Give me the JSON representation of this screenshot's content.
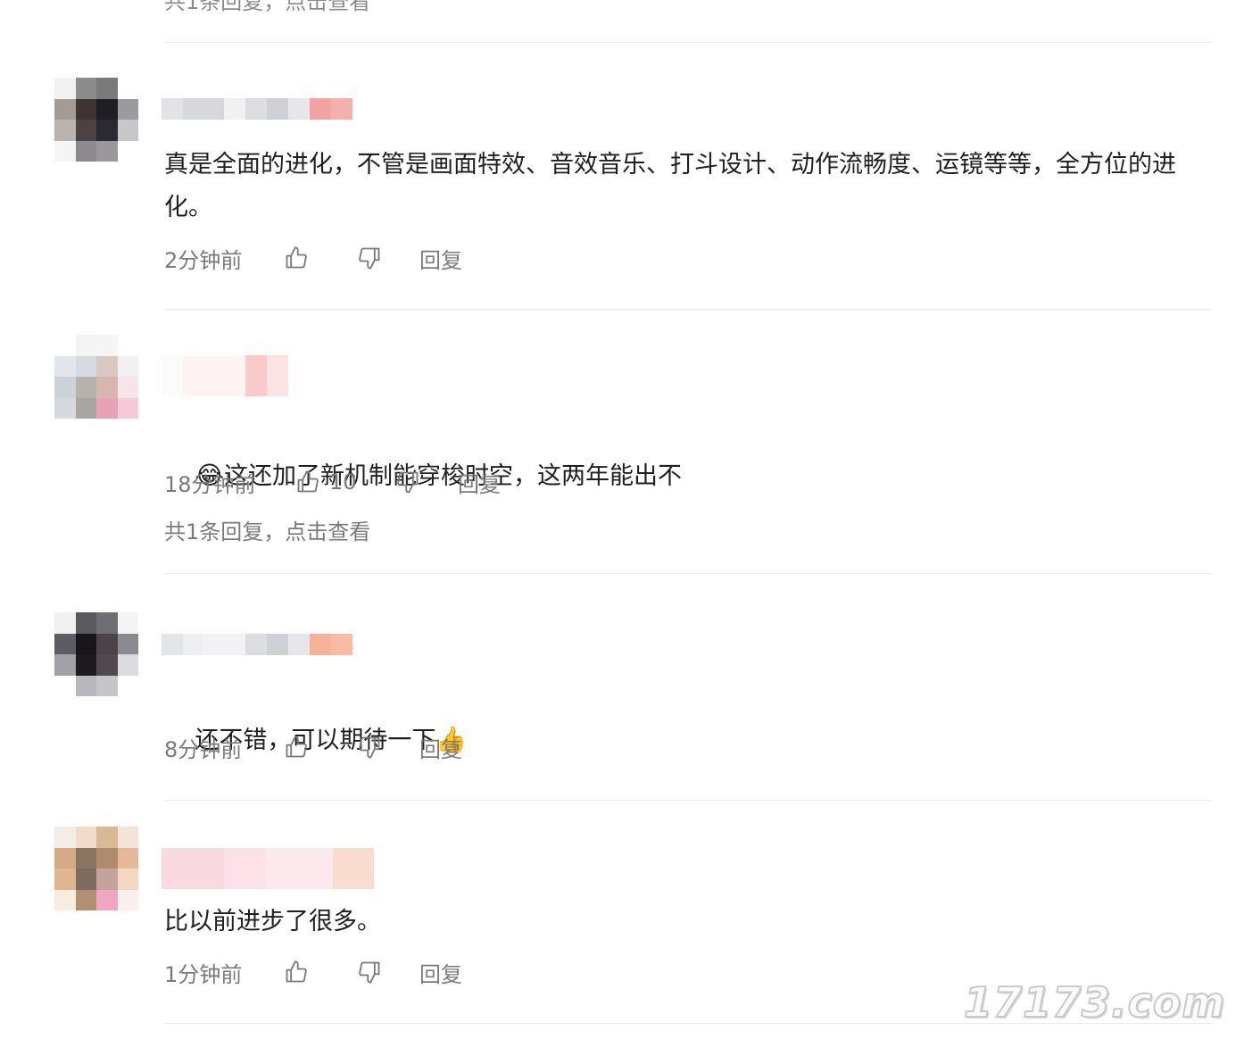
{
  "top_reply_link": "共1条回复，点击查看",
  "comments": [
    {
      "content": "真是全面的进化，不管是画面特效、音效音乐、打斗设计、动作流畅度、运镜等等，全方位的进化。",
      "time": "2分钟前",
      "like_count": "",
      "reply_label": "回复",
      "replies_link": ""
    },
    {
      "emoji": "😂",
      "content": "这还加了新机制能穿梭时空，这两年能出不",
      "time": "18分钟前",
      "like_count": "10",
      "reply_label": "回复",
      "replies_link": "共1条回复，点击查看"
    },
    {
      "content": "还不错，可以期待一下",
      "emoji_after": "👍",
      "time": "8分钟前",
      "like_count": "",
      "reply_label": "回复",
      "replies_link": ""
    },
    {
      "content": "比以前进步了很多。",
      "time": "1分钟前",
      "like_count": "",
      "reply_label": "回复",
      "replies_link": ""
    }
  ],
  "icons": {
    "like": "thumbs-up-icon",
    "dislike": "thumbs-down-icon"
  },
  "colors": {
    "text": "#1f1f1f",
    "meta": "#7a7a7a",
    "divider": "#ececec"
  },
  "watermark": "17173.com"
}
